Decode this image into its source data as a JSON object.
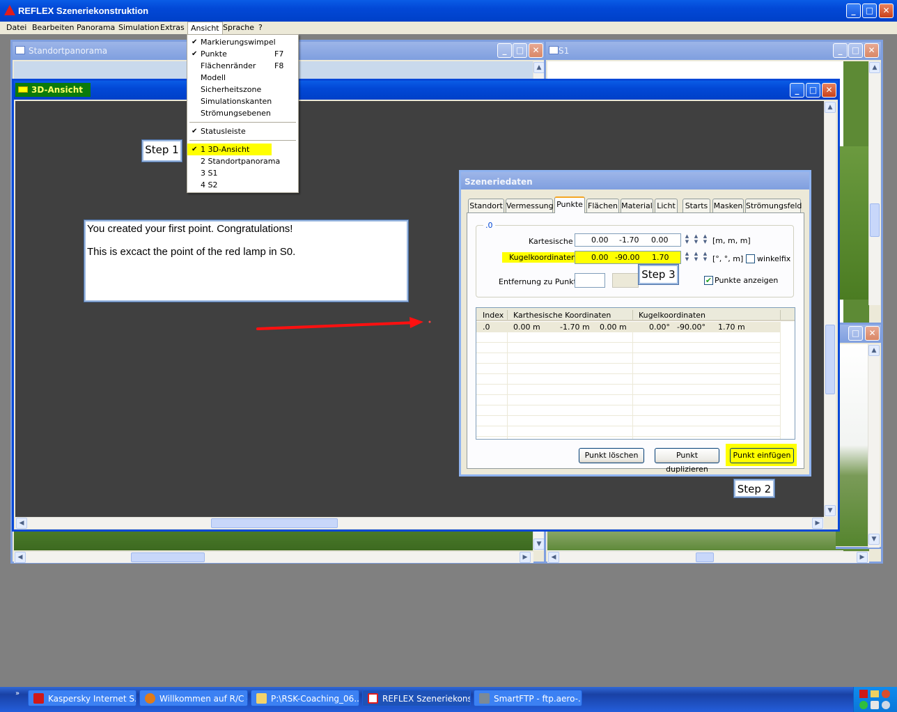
{
  "app": {
    "title": "REFLEX Szeneriekonstruktion"
  },
  "menubar": [
    "Datei",
    "Bearbeiten",
    "Panorama",
    "Simulation",
    "Extras",
    "Ansicht",
    "Sprache",
    "?"
  ],
  "ansicht_menu": {
    "items": [
      {
        "label": "Markierungswimpel",
        "checked": true,
        "shortcut": ""
      },
      {
        "label": "Punkte",
        "checked": true,
        "shortcut": "F7"
      },
      {
        "label": "Flächenränder",
        "checked": false,
        "shortcut": "F8"
      },
      {
        "label": "Modell",
        "checked": false,
        "shortcut": ""
      },
      {
        "label": "Sicherheitszone",
        "checked": false,
        "shortcut": ""
      },
      {
        "label": "Simulationskanten",
        "checked": false,
        "shortcut": ""
      },
      {
        "label": "Strömungsebenen",
        "checked": false,
        "shortcut": ""
      },
      {
        "label": "Statusleiste",
        "checked": true,
        "shortcut": ""
      },
      {
        "label": "1 3D-Ansicht",
        "checked": true,
        "shortcut": ""
      },
      {
        "label": "2 Standortpanorama",
        "checked": false,
        "shortcut": ""
      },
      {
        "label": "3 S1",
        "checked": false,
        "shortcut": ""
      },
      {
        "label": "4 S2",
        "checked": false,
        "shortcut": ""
      }
    ],
    "highlight_color": "#ffff00"
  },
  "windows": {
    "standort": "Standortpanorama",
    "s1": "S1",
    "ansicht3d": "3D-Ansicht"
  },
  "callouts": {
    "step1": "Step 1",
    "step2": "Step 2",
    "step3": "Step 3"
  },
  "info_box": {
    "line1": "You created your first point. Congratulations!",
    "line2": "This is excact the point of the red lamp in S0."
  },
  "dialog": {
    "title": "Szeneriedaten",
    "tabs": [
      "Standort",
      "Vermessung",
      "Punkte",
      "Flächen",
      "Material",
      "Licht",
      "Starts",
      "Masken",
      "Strömungsfeld"
    ],
    "active_tab": "Punkte",
    "group_label": ".0",
    "kartesische": {
      "label": "Kartesische",
      "values": [
        "0.00",
        "-1.70",
        "0.00"
      ],
      "unit": "[m, m, m]"
    },
    "kugel": {
      "label": "Kugelkoordinaten",
      "values": [
        "0.00",
        "-90.00",
        "1.70"
      ],
      "unit": "[°, °, m]"
    },
    "winkelfix": "winkelfix",
    "entfernung": "Entfernung zu Punkt",
    "punkte_anzeigen": "Punkte anzeigen",
    "table": {
      "headers": [
        "Index",
        "Karthesische Koordinaten",
        "Kugelkoordinaten"
      ],
      "row": {
        "index": ".0",
        "kart": [
          "0.00 m",
          "-1.70 m",
          "0.00 m"
        ],
        "kugel": [
          "0.00°",
          "-90.00°",
          "1.70 m"
        ]
      }
    },
    "buttons": {
      "loeschen": "Punkt löschen",
      "duplizieren": "Punkt duplizieren",
      "einfuegen": "Punkt einfügen"
    }
  },
  "taskbar": {
    "tasks": [
      "Kaspersky Internet S...",
      "Willkommen auf R/C -...",
      "P:\\RSK-Coaching_06...",
      "REFLEX Szeneriekons...",
      "SmartFTP - ftp.aero-..."
    ],
    "active": 3
  },
  "colors": {
    "accent": "#0a5ce6",
    "highlight": "#ffff00",
    "arrow": "#ff0000",
    "viewport": "#404040"
  }
}
